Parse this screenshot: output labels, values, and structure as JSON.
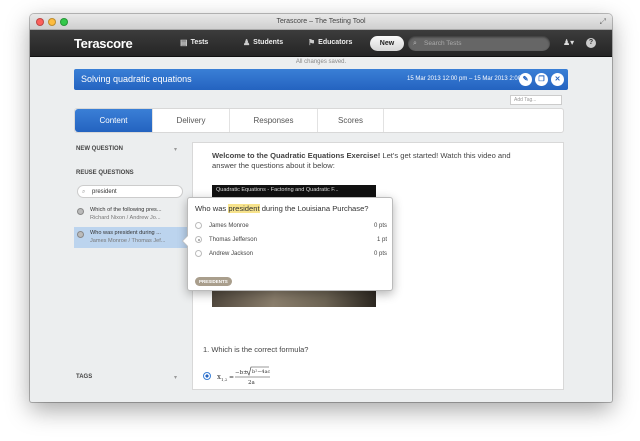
{
  "window": {
    "title": "Terascore – The Testing Tool"
  },
  "nav": {
    "logo": "Terascore",
    "items": [
      {
        "label": "Tests",
        "icon": "document-icon"
      },
      {
        "label": "Students",
        "icon": "students-icon"
      },
      {
        "label": "Educators",
        "icon": "educators-icon"
      }
    ],
    "new_label": "New",
    "search_placeholder": "Search Tests"
  },
  "status": "All changes saved.",
  "test": {
    "title": "Solving quadratic equations",
    "dates": "15 Mar 2013  12:00 pm  –  15 Mar 2013  2:00 pm",
    "add_tag_placeholder": "Add Tag..."
  },
  "tabs": [
    "Content",
    "Delivery",
    "Responses",
    "Scores"
  ],
  "active_tab": "Content",
  "sidebar": {
    "new_question": "NEW QUESTION",
    "reuse_questions": "REUSE QUESTIONS",
    "search_value": "president",
    "results": [
      {
        "title": "Which of the following pres...",
        "answers": "Richard Nixon / Andrew Jo..."
      },
      {
        "title": "Who was president during ...",
        "answers": "James Monroe / Thomas Jef..."
      }
    ],
    "tags": "TAGS"
  },
  "content": {
    "intro_bold": "Welcome to the Quadratic Equations Exercise!",
    "intro_rest": " Let's get started! Watch this video and answer the questions about it below:",
    "video_title": "Quadratic Equations - Factoring and Quadratic F...",
    "question1": "1.  Which is the correct formula?"
  },
  "popup": {
    "question_before": "Who was ",
    "question_highlight": "president",
    "question_after": " during the Louisiana Purchase?",
    "options": [
      {
        "label": "James Monroe",
        "points": "0 pts",
        "checked": false
      },
      {
        "label": "Thomas Jefferson",
        "points": "1 pt",
        "checked": true
      },
      {
        "label": "Andrew Jackson",
        "points": "0 pts",
        "checked": false
      }
    ],
    "tag": "PRESIDENTS"
  }
}
